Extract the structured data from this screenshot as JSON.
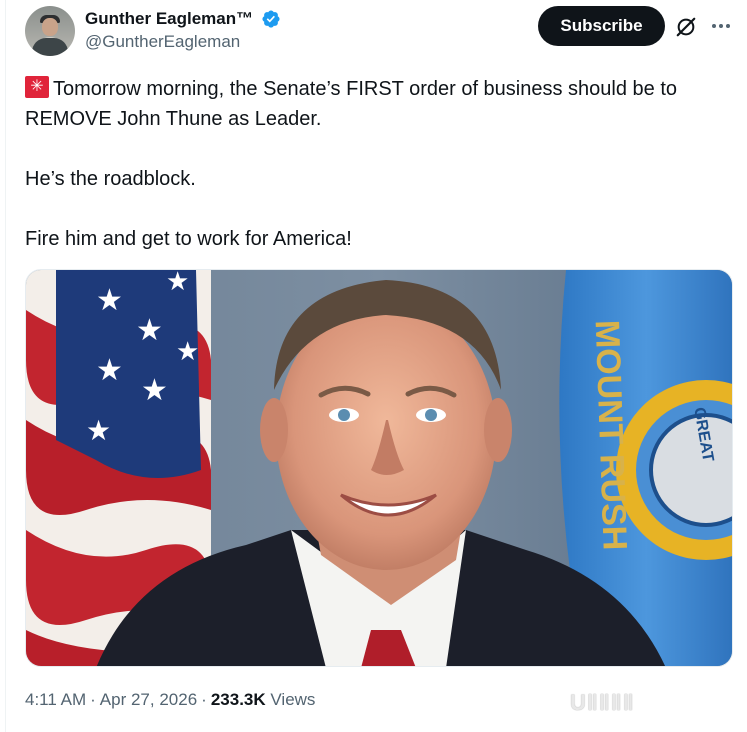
{
  "author": {
    "display_name": "Gunther Eagleman™",
    "handle": "@GuntherEagleman",
    "verified": true
  },
  "actions": {
    "subscribe_label": "Subscribe",
    "grok_icon": "grok-icon",
    "more_icon": "more-icon"
  },
  "tweet": {
    "emoji": "siren-emoji",
    "line1": "Tomorrow morning, the Senate’s FIRST order of business should be to REMOVE John Thune as Leader.",
    "line2": "He’s the roadblock.",
    "line3": "Fire him and get to work for America!"
  },
  "media": {
    "flag_text": "MOUNT RUSH",
    "seal_text": "GREAT"
  },
  "meta": {
    "time": "4:11 AM",
    "date": "Apr 27, 2026",
    "views_count": "233.3K",
    "views_label": "Views"
  },
  "watermark": "U‖‖‖‖",
  "colors": {
    "primary_text": "#0f1419",
    "secondary_text": "#536471",
    "verified_blue": "#1d9bf0",
    "subscribe_bg": "#0f1419"
  }
}
